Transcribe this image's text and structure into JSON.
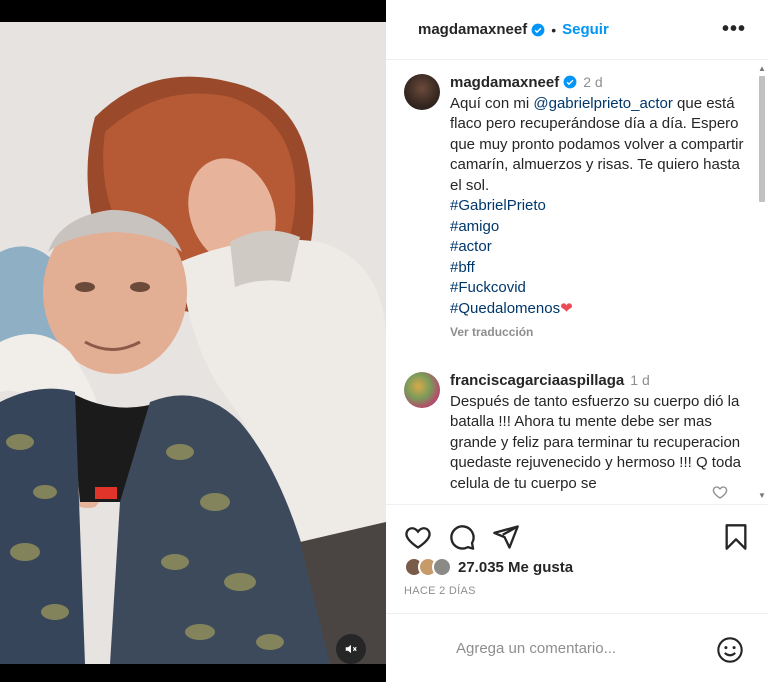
{
  "post": {
    "username": "magdamaxneef",
    "follow_label": "Seguir",
    "more_label": "•••"
  },
  "caption": {
    "username": "magdamaxneef",
    "time": "2 d",
    "text_before": "Aquí con mi ",
    "mention": "@gabrielprieto_actor",
    "text_after": " que está flaco pero recuperándose día a día. Espero que muy pronto podamos volver a compartir camarín, almuerzos y risas. Te quiero hasta el sol.",
    "hashtags": [
      "#GabrielPrieto",
      "#amigo",
      "#actor",
      "#bff",
      "#Fuckcovid",
      "#Quedalomenos"
    ],
    "heart": "❤",
    "translate_label": "Ver traducción"
  },
  "comment": {
    "username": "franciscagarciaaspillaga",
    "time": "1 d",
    "text": "Después de tanto esfuerzo su cuerpo dió la batalla !!! Ahora tu mente debe ser mas grande y feliz para terminar tu recuperacion quedaste rejuvenecido y hermoso !!! Q toda celula de tu cuerpo se"
  },
  "likes": {
    "count_label": "27.035 Me gusta",
    "ago": "HACE 2 DÍAS"
  },
  "input": {
    "placeholder": "Agrega un comentario..."
  },
  "icons": [
    "verified-badge-icon",
    "more-icon",
    "heart-icon",
    "comment-icon",
    "share-icon",
    "bookmark-icon",
    "emoji-icon",
    "mute-icon"
  ],
  "colors": {
    "accent": "#0095f6",
    "link": "#00376b",
    "muted": "#8e8e8e",
    "heart": "#ed4956"
  }
}
